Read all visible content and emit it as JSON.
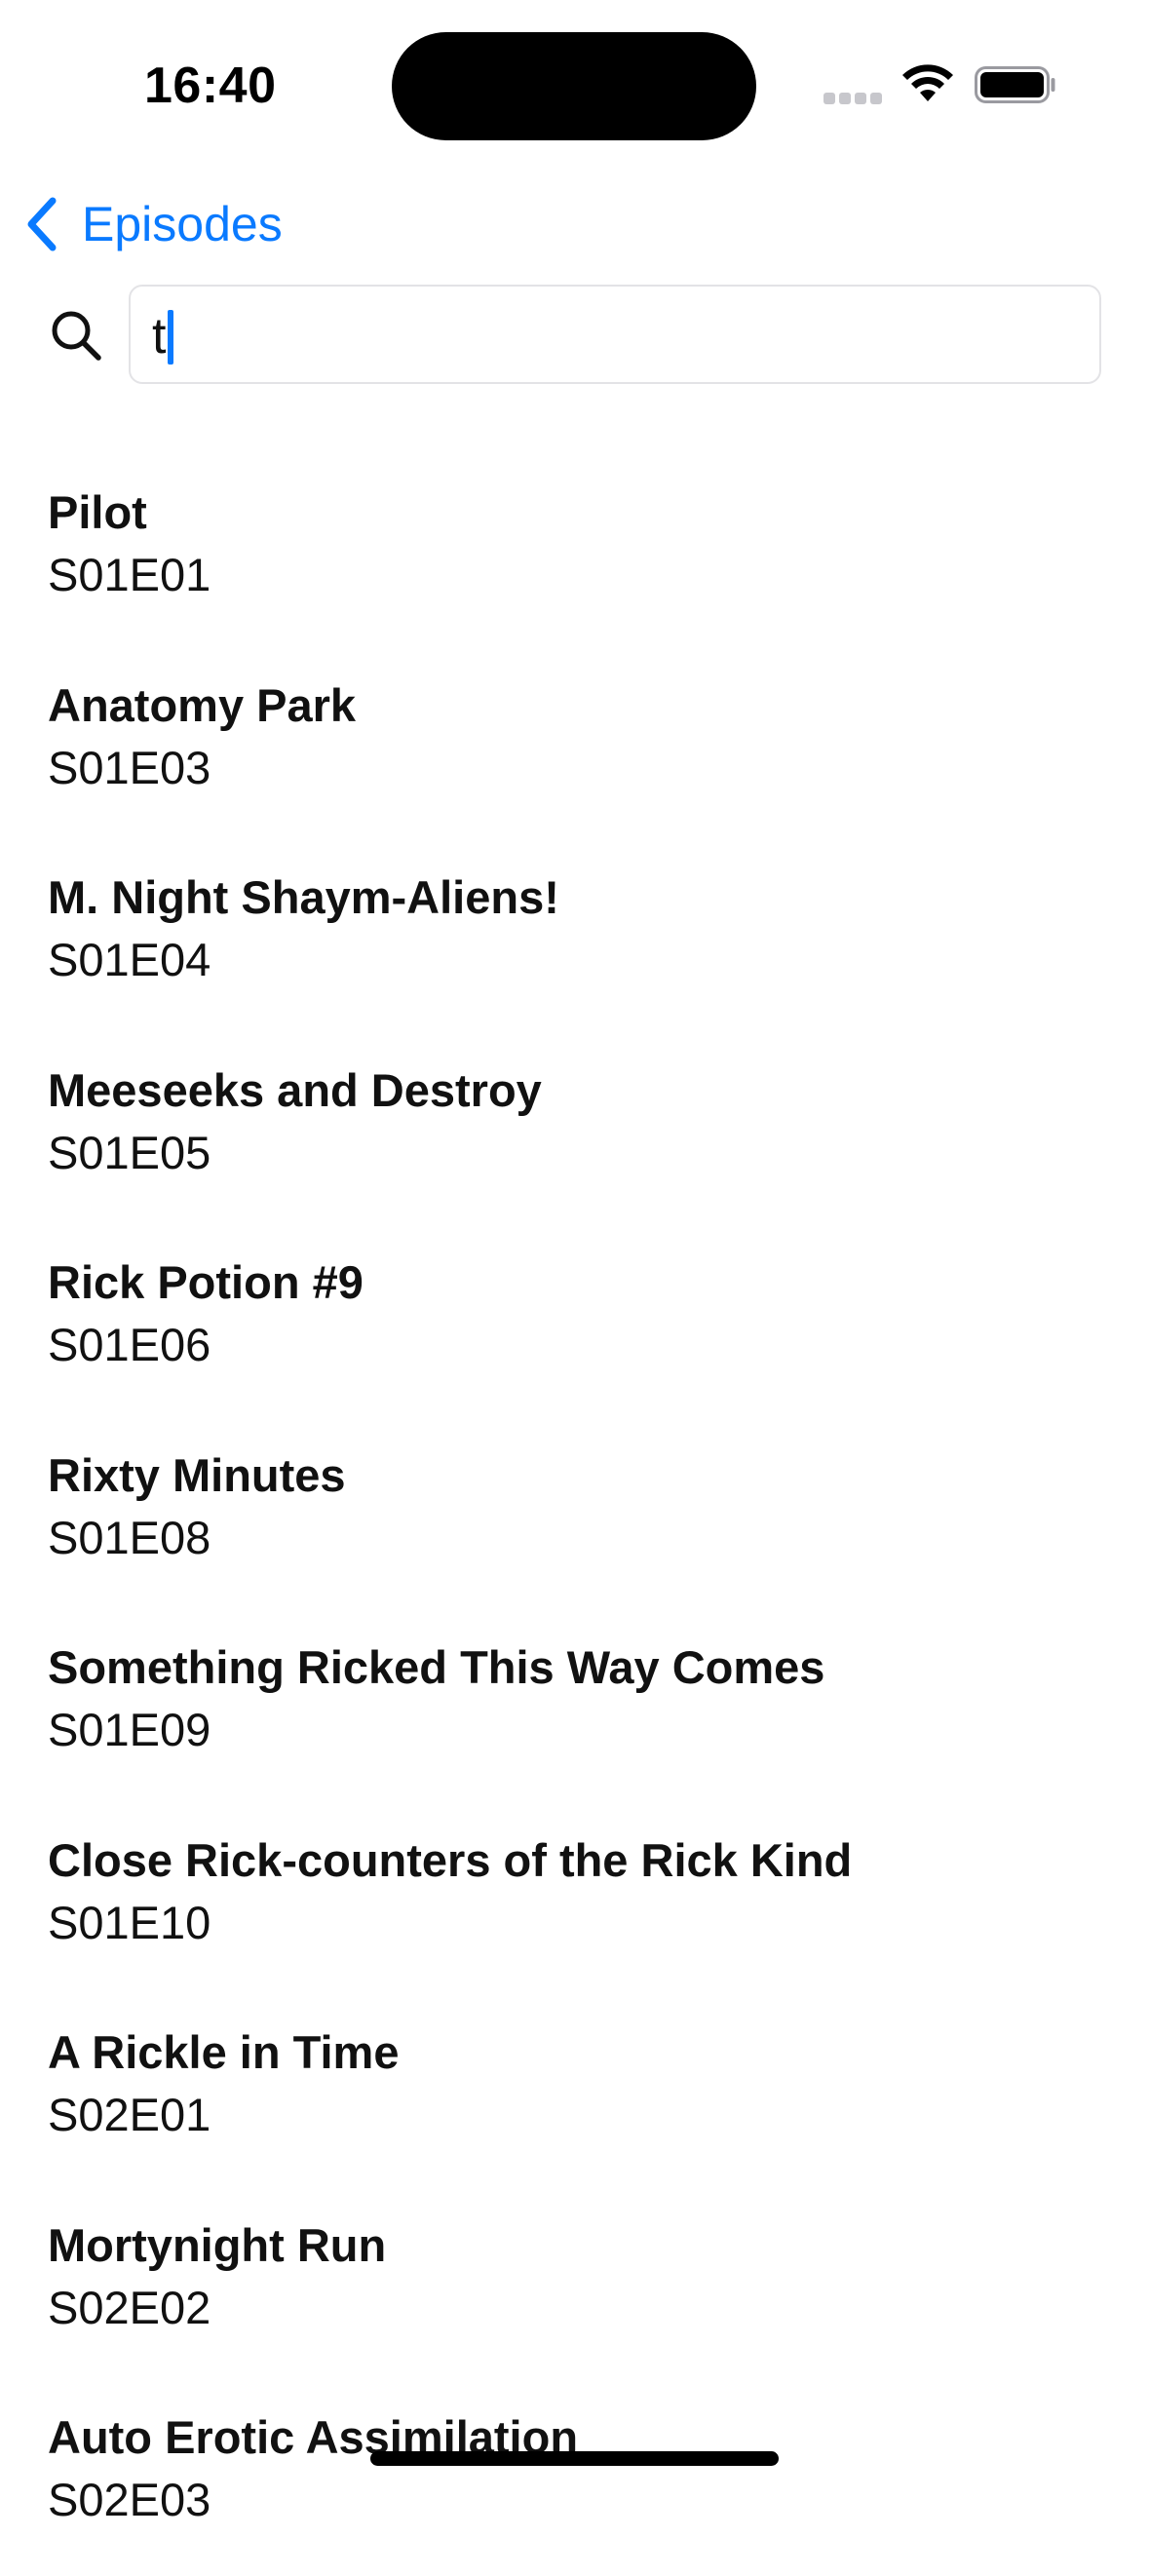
{
  "status_bar": {
    "time": "16:40"
  },
  "nav": {
    "back_label": "Episodes",
    "back_icon": "chevron-left-icon"
  },
  "search": {
    "icon": "search-icon",
    "value": "t",
    "placeholder": ""
  },
  "colors": {
    "accent": "#0a7aff",
    "text": "#111111",
    "field_border": "#e3e3e6"
  },
  "episodes": [
    {
      "title": "Pilot",
      "code": "S01E01"
    },
    {
      "title": "Anatomy Park",
      "code": "S01E03"
    },
    {
      "title": "M. Night Shaym-Aliens!",
      "code": "S01E04"
    },
    {
      "title": "Meeseeks and Destroy",
      "code": "S01E05"
    },
    {
      "title": "Rick Potion #9",
      "code": "S01E06"
    },
    {
      "title": "Rixty Minutes",
      "code": "S01E08"
    },
    {
      "title": "Something Ricked This Way Comes",
      "code": "S01E09"
    },
    {
      "title": "Close Rick-counters of the Rick Kind",
      "code": "S01E10"
    },
    {
      "title": "A Rickle in Time",
      "code": "S02E01"
    },
    {
      "title": "Mortynight Run",
      "code": "S02E02"
    },
    {
      "title": "Auto Erotic Assimilation",
      "code": "S02E03"
    }
  ]
}
